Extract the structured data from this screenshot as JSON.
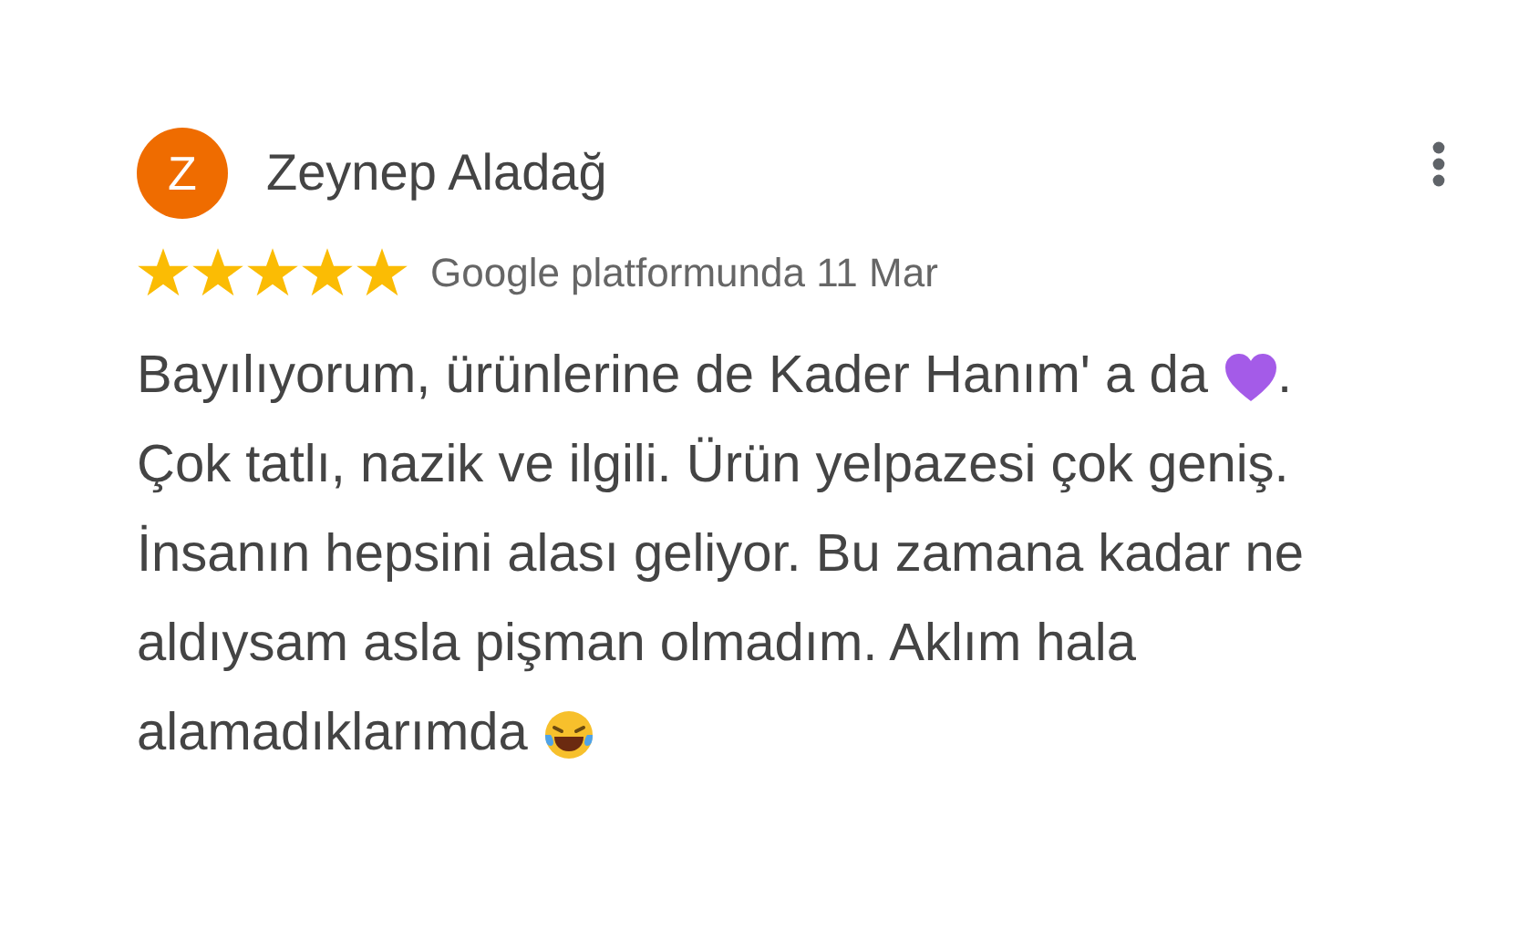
{
  "review": {
    "avatar_initial": "Z",
    "author": "Zeynep Aladağ",
    "stars": 5,
    "meta": "Google platformunda 11 Mar",
    "lines": [
      [
        {
          "kind": "text",
          "text": "Bayılıyorum, ürünlerine de Kader Hanım' a da "
        },
        {
          "kind": "heart"
        },
        {
          "kind": "text",
          "text": "."
        }
      ],
      [
        {
          "kind": "text",
          "text": "Çok tatlı, nazik ve ilgili. Ürün yelpazesi çok geniş."
        }
      ],
      [
        {
          "kind": "text",
          "text": "İnsanın hepsini alası geliyor. Bu zamana kadar ne"
        }
      ],
      [
        {
          "kind": "text",
          "text": "aldıysam asla pişman olmadım. Aklım hala"
        }
      ],
      [
        {
          "kind": "text",
          "text": "alamadıklarımda "
        },
        {
          "kind": "laughing"
        }
      ]
    ]
  }
}
